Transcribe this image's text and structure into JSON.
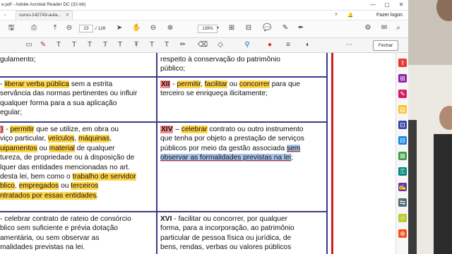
{
  "window": {
    "title": "e.pdf - Adobe Acrobat Reader DC (32-bit)",
    "minimize": "—",
    "maximize": "▢",
    "close": "✕"
  },
  "tabs": [
    {
      "label": "curso-142743-aula...",
      "close": "✕"
    }
  ],
  "account": {
    "login": "Fazer logon"
  },
  "toolbar": {
    "page_current": "23",
    "page_total": "/ 126",
    "zoom": "139%"
  },
  "comment_toolbar": {
    "close_label": "Fechar"
  },
  "document": {
    "left_col": [
      {
        "lines": [
          "gulamento;"
        ]
      },
      {
        "lines": [
          "- liberar verba pública sem a estrita",
          "servância das normas pertinentes ou influir",
          "qualquer forma para a sua aplicação",
          "egular;"
        ]
      },
      {
        "lines": [
          "- permitir que se utilize, em obra ou",
          "viço particular, veículos, máquinas,",
          "uipamentos ou material de qualquer",
          "tureza, de propriedade ou à disposição de",
          "lquer das entidades mencionadas no art.",
          "desta lei, bem como o trabalho de servidor",
          "blico, empregados ou terceiros",
          "ntratados por essas entidades."
        ]
      },
      {
        "lines": [
          "- celebrar contrato de rateio de consórcio",
          "blico sem suficiente e prévia dotação",
          "amentária, ou sem observar as",
          "malidades previstas na lei."
        ]
      }
    ],
    "right_col": [
      {
        "lines": [
          "respeito à conservação do patrimônio",
          "público;"
        ]
      },
      {
        "numeral": "XII",
        "lines": [
          "- permitir, facilitar ou concorrer para que",
          "terceiro se enriqueça ilicitamente;"
        ]
      },
      {
        "numeral": "XIV",
        "lines": [
          "– celebrar contrato ou outro instrumento",
          "que tenha por objeto a prestação de serviços",
          "públicos por meio da gestão associada sem",
          "observar as formalidades previstas na lei;"
        ]
      },
      {
        "numeral": "XVI",
        "lines": [
          "- facilitar ou concorrer, por qualquer",
          "forma, para a incorporação, ao patrimônio",
          "particular de pessoa física ou jurídica, de",
          "bens, rendas, verbas ou valores públicos"
        ]
      }
    ]
  },
  "colors": {
    "highlight": "#ffd54a",
    "numeral": "#f48a8a",
    "selection": "#a9c5eb",
    "table_border": "#3a3a8c",
    "red_rule": "#d21d1d"
  }
}
